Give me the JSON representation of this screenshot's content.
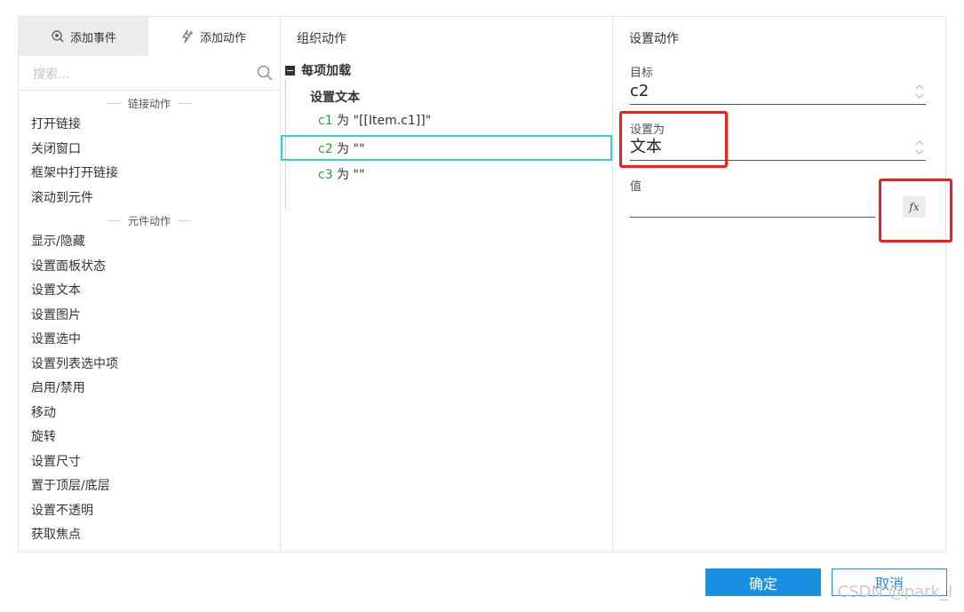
{
  "tabs": {
    "add_event": "添加事件",
    "add_action": "添加动作"
  },
  "search": {
    "placeholder": "搜索..."
  },
  "left_list": {
    "sections": [
      {
        "title": "链接动作",
        "items": [
          "打开链接",
          "关闭窗口",
          "框架中打开链接",
          "滚动到元件"
        ]
      },
      {
        "title": "元件动作",
        "items": [
          "显示/隐藏",
          "设置面板状态",
          "设置文本",
          "设置图片",
          "设置选中",
          "设置列表选中项",
          "启用/禁用",
          "移动",
          "旋转",
          "设置尺寸",
          "置于顶层/底层",
          "设置不透明",
          "获取焦点"
        ]
      }
    ]
  },
  "middle": {
    "title": "组织动作",
    "root": "每项加载",
    "action": "设置文本",
    "rows": [
      {
        "target": "c1",
        "sep": " 为 ",
        "value": "\"[[Item.c1]]\""
      },
      {
        "target": "c2",
        "sep": " 为 ",
        "value": "\"\""
      },
      {
        "target": "c3",
        "sep": " 为 ",
        "value": "\"\""
      }
    ]
  },
  "right": {
    "title": "设置动作",
    "target_label": "目标",
    "target_value": "c2",
    "setas_label": "设置为",
    "setas_value": "文本",
    "value_label": "值",
    "value_value": "",
    "fx_label": "fx"
  },
  "footer": {
    "ok": "确定",
    "cancel": "取消",
    "watermark": "CSDN @park_l"
  },
  "colors": {
    "accent": "#1a8fe0",
    "selection_border": "#2fd3d6",
    "highlight_box": "#ff1a1a",
    "target_text": "#2e9e2e"
  }
}
